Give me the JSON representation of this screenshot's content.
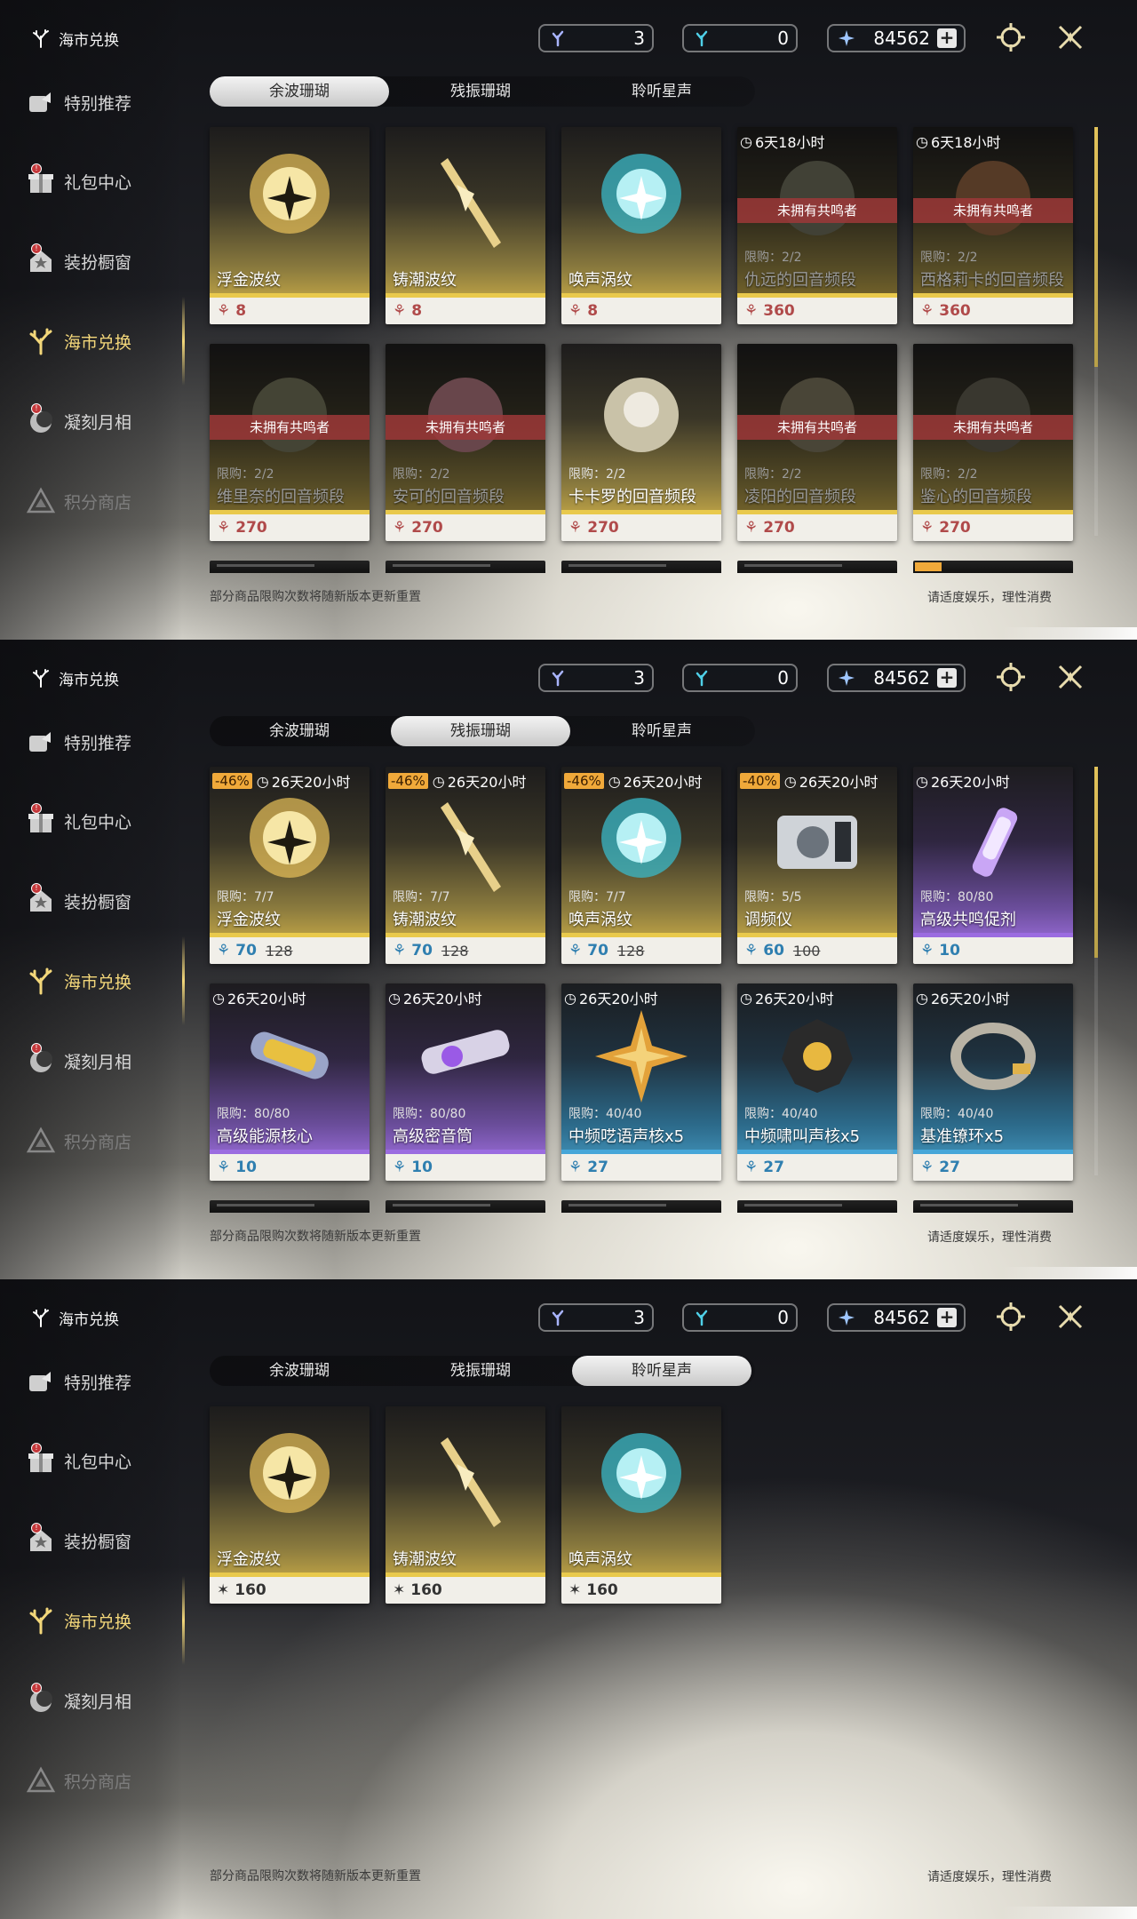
{
  "screens": [
    {
      "sidebar": {
        "brand": "海市兑换",
        "items": [
          {
            "label": "特别推荐"
          },
          {
            "label": "礼包中心",
            "badge": "!"
          },
          {
            "label": "装扮橱窗",
            "badge": "!"
          },
          {
            "label": "海市兑换"
          },
          {
            "label": "凝刻月相",
            "badge": "!"
          },
          {
            "label": "积分商店"
          }
        ]
      },
      "currencies": {
        "c1": "3",
        "c2": "0",
        "c3": "84562",
        "plus": "+"
      },
      "tabs": [
        "余波珊瑚",
        "残振珊瑚",
        "聆听星声"
      ],
      "active_tab": "余波珊瑚",
      "cards": [
        {
          "name": "浮金波纹",
          "price": "8"
        },
        {
          "name": "铸潮波纹",
          "price": "8"
        },
        {
          "name": "唤声涡纹",
          "price": "8"
        },
        {
          "name": "仇远的回音频段",
          "price": "360",
          "timer": "6天18小时",
          "limit": "限购：2/2",
          "ribbon": "未拥有共鸣者"
        },
        {
          "name": "西格莉卡的回音频段",
          "price": "360",
          "timer": "6天18小时",
          "limit": "限购：2/2",
          "ribbon": "未拥有共鸣者"
        },
        {
          "name": "维里奈的回音频段",
          "price": "270",
          "limit": "限购：2/2",
          "ribbon": "未拥有共鸣者"
        },
        {
          "name": "安可的回音频段",
          "price": "270",
          "limit": "限购：2/2",
          "ribbon": "未拥有共鸣者"
        },
        {
          "name": "卡卡罗的回音频段",
          "price": "270",
          "limit": "限购：2/2"
        },
        {
          "name": "凌阳的回音频段",
          "price": "270",
          "limit": "限购：2/2",
          "ribbon": "未拥有共鸣者"
        },
        {
          "name": "鉴心的回音频段",
          "price": "270",
          "limit": "限购：2/2",
          "ribbon": "未拥有共鸣者"
        }
      ],
      "footer_left": "部分商品限购次数将随新版本更新重置",
      "footer_right": "请适度娱乐，理性消费"
    },
    {
      "sidebar": {
        "brand": "海市兑换",
        "items": [
          {
            "label": "特别推荐"
          },
          {
            "label": "礼包中心",
            "badge": "!"
          },
          {
            "label": "装扮橱窗",
            "badge": "!"
          },
          {
            "label": "海市兑换"
          },
          {
            "label": "凝刻月相",
            "badge": "!"
          },
          {
            "label": "积分商店"
          }
        ]
      },
      "currencies": {
        "c1": "3",
        "c2": "0",
        "c3": "84562",
        "plus": "+"
      },
      "tabs": [
        "余波珊瑚",
        "残振珊瑚",
        "聆听星声"
      ],
      "active_tab": "残振珊瑚",
      "cards": [
        {
          "name": "浮金波纹",
          "discount": "-46%",
          "timer": "26天20小时",
          "limit": "限购：7/7",
          "price": "70",
          "old_price": "128"
        },
        {
          "name": "铸潮波纹",
          "discount": "-46%",
          "timer": "26天20小时",
          "limit": "限购：7/7",
          "price": "70",
          "old_price": "128"
        },
        {
          "name": "唤声涡纹",
          "discount": "-46%",
          "timer": "26天20小时",
          "limit": "限购：7/7",
          "price": "70",
          "old_price": "128"
        },
        {
          "name": "调频仪",
          "discount": "-40%",
          "timer": "26天20小时",
          "limit": "限购：5/5",
          "price": "60",
          "old_price": "100"
        },
        {
          "name": "高级共鸣促剂",
          "timer": "26天20小时",
          "limit": "限购：80/80",
          "price": "10"
        },
        {
          "name": "高级能源核心",
          "timer": "26天20小时",
          "limit": "限购：80/80",
          "price": "10"
        },
        {
          "name": "高级密音筒",
          "timer": "26天20小时",
          "limit": "限购：80/80",
          "price": "10"
        },
        {
          "name": "中频呓语声核x5",
          "timer": "26天20小时",
          "limit": "限购：40/40",
          "price": "27"
        },
        {
          "name": "中频啸叫声核x5",
          "timer": "26天20小时",
          "limit": "限购：40/40",
          "price": "27"
        },
        {
          "name": "基准镣环x5",
          "timer": "26天20小时",
          "limit": "限购：40/40",
          "price": "27"
        }
      ],
      "footer_left": "部分商品限购次数将随新版本更新重置",
      "footer_right": "请适度娱乐，理性消费"
    },
    {
      "sidebar": {
        "brand": "海市兑换",
        "items": [
          {
            "label": "特别推荐"
          },
          {
            "label": "礼包中心",
            "badge": "!"
          },
          {
            "label": "装扮橱窗",
            "badge": "!"
          },
          {
            "label": "海市兑换"
          },
          {
            "label": "凝刻月相",
            "badge": "!"
          },
          {
            "label": "积分商店"
          }
        ]
      },
      "currencies": {
        "c1": "3",
        "c2": "0",
        "c3": "84562",
        "plus": "+"
      },
      "tabs": [
        "余波珊瑚",
        "残振珊瑚",
        "聆听星声"
      ],
      "active_tab": "聆听星声",
      "cards": [
        {
          "name": "浮金波纹",
          "price": "160"
        },
        {
          "name": "铸潮波纹",
          "price": "160"
        },
        {
          "name": "唤声涡纹",
          "price": "160"
        }
      ],
      "footer_left": "部分商品限购次数将随新版本更新重置",
      "footer_right": "请适度娱乐，理性消费"
    }
  ],
  "colors": {
    "accent": "#f3d77a",
    "sold_out_ribbon": "#9e3838",
    "discount": "#f0a93a"
  }
}
